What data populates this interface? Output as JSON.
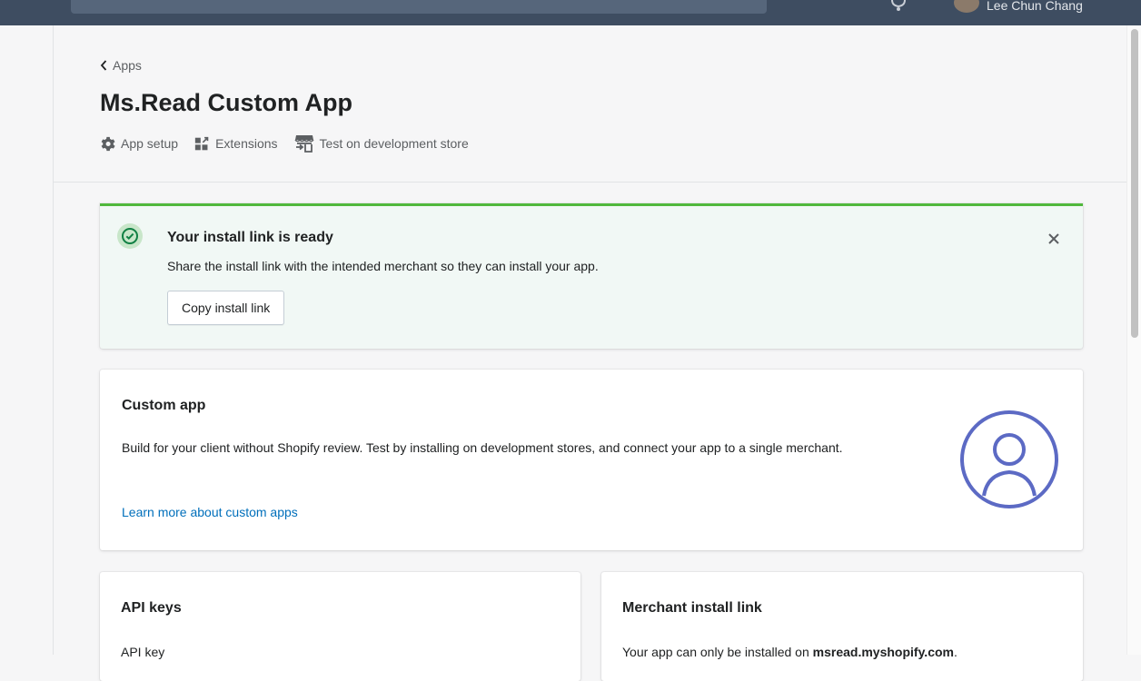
{
  "topbar": {
    "user_name": "Lee Chun Chang"
  },
  "header": {
    "breadcrumb_label": "Apps",
    "title": "Ms.Read Custom App",
    "actions": [
      {
        "label": "App setup",
        "icon": "gear-icon"
      },
      {
        "label": "Extensions",
        "icon": "extensions-icon"
      },
      {
        "label": "Test on development store",
        "icon": "store-icon"
      }
    ]
  },
  "banner": {
    "title": "Your install link is ready",
    "text": "Share the install link with the intended merchant so they can install your app.",
    "button_label": "Copy install link",
    "status_color": "#50b83c"
  },
  "custom_app_card": {
    "title": "Custom app",
    "description": "Build for your client without Shopify review. Test by installing on development stores, and connect your app to a single merchant.",
    "link_text": "Learn more about custom apps",
    "illustration": "user-circle-icon",
    "accent_color": "#5c6ac4"
  },
  "api_keys_card": {
    "title": "API keys",
    "field_label": "API key"
  },
  "merchant_card": {
    "title": "Merchant install link",
    "text_prefix": "Your app can only be installed on ",
    "store_domain": "msread.myshopify.com",
    "text_suffix": "."
  }
}
